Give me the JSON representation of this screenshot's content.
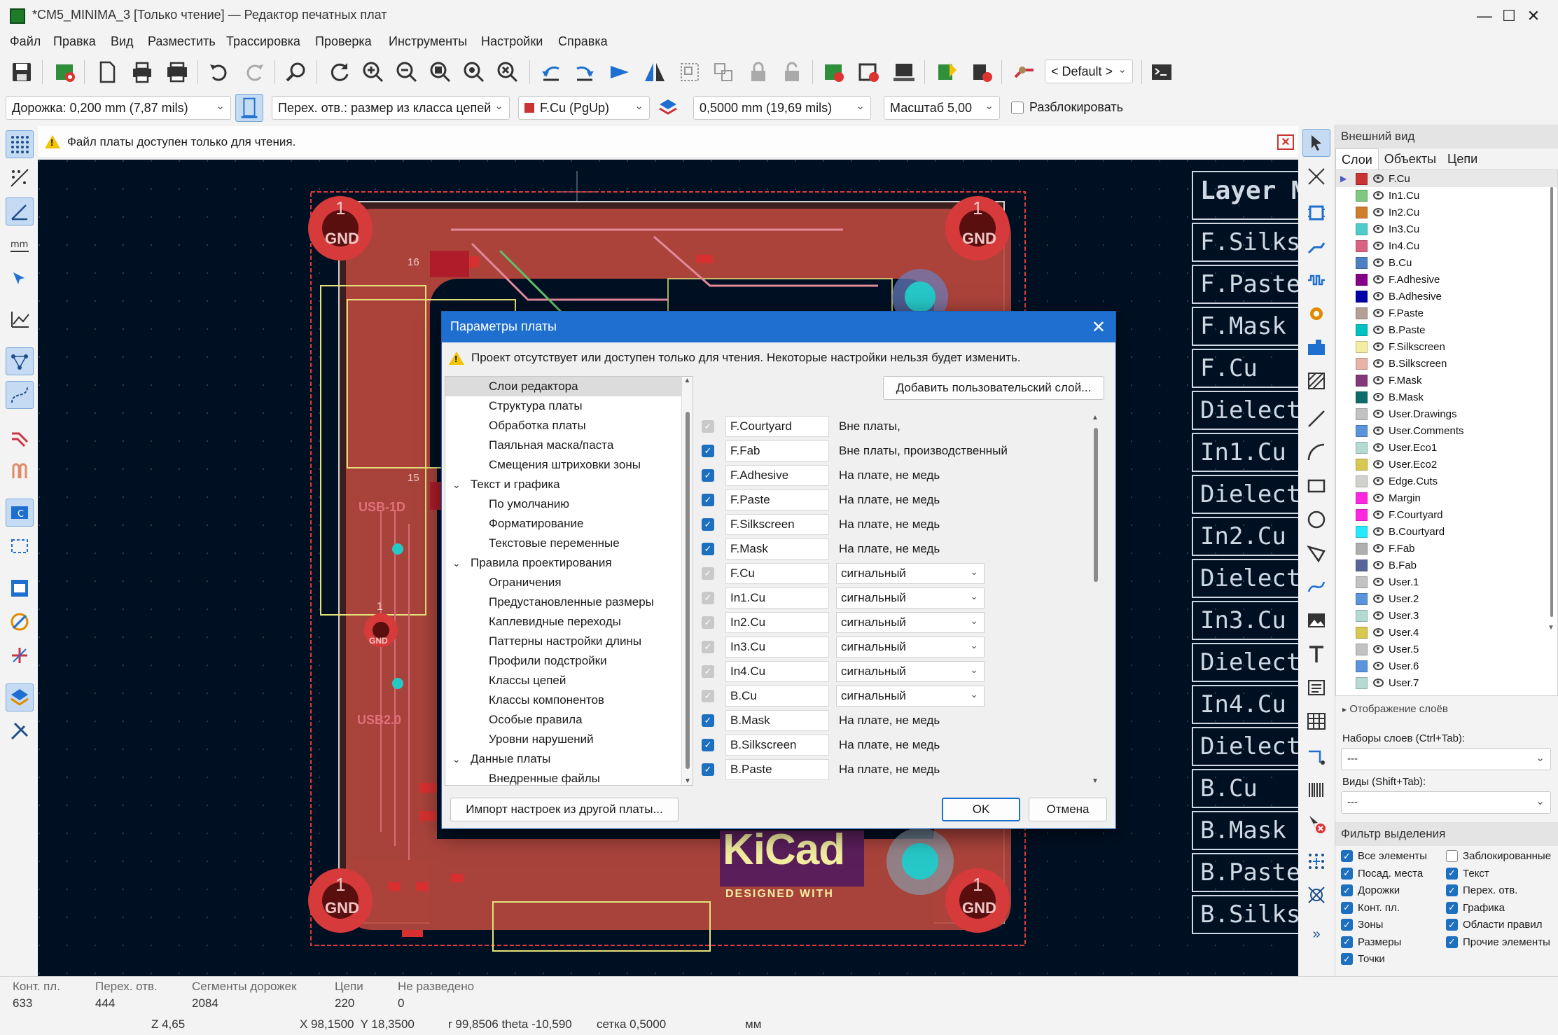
{
  "window": {
    "title": "*CM5_MINIMA_3 [Только чтение] — Редактор печатных плат",
    "controls": {
      "minimize": "—",
      "maximize": "☐",
      "close": "✕"
    }
  },
  "menu": [
    "Файл",
    "Правка",
    "Вид",
    "Разместить",
    "Трассировка",
    "Проверка",
    "Инструменты",
    "Настройки",
    "Справка"
  ],
  "toolbar": {
    "viewport_preset": "< Default >"
  },
  "auxbar": {
    "track_width": "Дорожка: 0,200 mm (7,87 mils)",
    "via_size": "Перех. отв.: размер из класса цепей",
    "layer": "F.Cu (PgUp)",
    "grid": "0,5000 mm (19,69 mils)",
    "zoom": "Масштаб 5,00",
    "unlock_label": "Разблокировать"
  },
  "infobar": {
    "message": "Файл платы доступен только для чтения."
  },
  "canvas": {
    "gnd_label": "GND",
    "pad_number": "1",
    "kicad_text": "KiCad",
    "kicad_sub": "DESIGNED WITH",
    "labels": [
      "16",
      "15",
      "USB-1D",
      "USB2.0"
    ],
    "layer_manager": [
      "Layer M",
      "F.Silksc",
      "F.Paste",
      "F.Mask",
      "F.Cu",
      "Dielect",
      "In1.Cu",
      "Dielect",
      "In2.Cu",
      "Dielect",
      "In3.Cu",
      "Dielect",
      "In4.Cu",
      "Dielect",
      "B.Cu",
      "B.Mask",
      "B.Paste",
      "B.Silksc"
    ]
  },
  "appearance": {
    "title": "Внешний вид",
    "tabs": [
      "Слои",
      "Объекты",
      "Цепи"
    ],
    "layers": [
      {
        "name": "F.Cu",
        "color": "#c83434"
      },
      {
        "name": "In1.Cu",
        "color": "#7fc87f"
      },
      {
        "name": "In2.Cu",
        "color": "#ce7d2c"
      },
      {
        "name": "In3.Cu",
        "color": "#4fcbcb"
      },
      {
        "name": "In4.Cu",
        "color": "#db6283"
      },
      {
        "name": "B.Cu",
        "color": "#4d7fc4"
      },
      {
        "name": "F.Adhesive",
        "color": "#84008a"
      },
      {
        "name": "B.Adhesive",
        "color": "#0000a8"
      },
      {
        "name": "F.Paste",
        "color": "#b49f94"
      },
      {
        "name": "B.Paste",
        "color": "#00c2c2"
      },
      {
        "name": "F.Silkscreen",
        "color": "#f2eda1"
      },
      {
        "name": "B.Silkscreen",
        "color": "#e8b2a7"
      },
      {
        "name": "F.Mask",
        "color": "#84377a"
      },
      {
        "name": "B.Mask",
        "color": "#0e6b6b"
      },
      {
        "name": "User.Drawings",
        "color": "#c2c2c2"
      },
      {
        "name": "User.Comments",
        "color": "#5994dc"
      },
      {
        "name": "User.Eco1",
        "color": "#b4dbd2"
      },
      {
        "name": "User.Eco2",
        "color": "#d8c852"
      },
      {
        "name": "Edge.Cuts",
        "color": "#d0d2cd"
      },
      {
        "name": "Margin",
        "color": "#ff26e2"
      },
      {
        "name": "F.Courtyard",
        "color": "#ff26e2"
      },
      {
        "name": "B.Courtyard",
        "color": "#26e9ff"
      },
      {
        "name": "F.Fab",
        "color": "#afafaf"
      },
      {
        "name": "B.Fab",
        "color": "#58659b"
      },
      {
        "name": "User.1",
        "color": "#c2c2c2"
      },
      {
        "name": "User.2",
        "color": "#5994dc"
      },
      {
        "name": "User.3",
        "color": "#b4dbd2"
      },
      {
        "name": "User.4",
        "color": "#d8c852"
      },
      {
        "name": "User.5",
        "color": "#c2c2c2"
      },
      {
        "name": "User.6",
        "color": "#5994dc"
      },
      {
        "name": "User.7",
        "color": "#b4dbd2"
      }
    ],
    "layer_display": "Отображение слоёв",
    "presets_label": "Наборы слоев (Ctrl+Tab):",
    "presets_value": "---",
    "views_label": "Виды (Shift+Tab):",
    "views_value": "---",
    "filter_title": "Фильтр выделения",
    "filter": [
      {
        "label": "Все элементы",
        "checked": true
      },
      {
        "label": "Заблокированные",
        "checked": false
      },
      {
        "label": "Посад. места",
        "checked": true
      },
      {
        "label": "Текст",
        "checked": true
      },
      {
        "label": "Дорожки",
        "checked": true
      },
      {
        "label": "Перех. отв.",
        "checked": true
      },
      {
        "label": "Конт. пл.",
        "checked": true
      },
      {
        "label": "Графика",
        "checked": true
      },
      {
        "label": "Зоны",
        "checked": true
      },
      {
        "label": "Области правил",
        "checked": true
      },
      {
        "label": "Размеры",
        "checked": true
      },
      {
        "label": "Прочие элементы",
        "checked": true
      },
      {
        "label": "Точки",
        "checked": true
      }
    ]
  },
  "status": {
    "items": [
      {
        "label": "Конт. пл.",
        "value": "633"
      },
      {
        "label": "Перех. отв.",
        "value": "444"
      },
      {
        "label": "Сегменты дорожек",
        "value": "2084"
      },
      {
        "label": "Цепи",
        "value": "220"
      },
      {
        "label": "Не разведено",
        "value": "0"
      }
    ],
    "z": "Z 4,65",
    "xy": "X 98,1500  Y 18,3500",
    "polar": "r 99,8506  theta -10,590",
    "grid": "сетка 0,5000",
    "units": "мм"
  },
  "dialog": {
    "title": "Параметры платы",
    "warning": "Проект отсутствует или доступен только для чтения. Некоторые настройки нельзя будет изменить.",
    "tree": [
      {
        "label": "Слои редактора",
        "level": 1,
        "selected": true
      },
      {
        "label": "Структура платы",
        "level": 1
      },
      {
        "label": "Обработка платы",
        "level": 1
      },
      {
        "label": "Паяльная маска/паста",
        "level": 1
      },
      {
        "label": "Смещения штриховки зоны",
        "level": 1
      },
      {
        "label": "Текст и графика",
        "level": 0
      },
      {
        "label": "По умолчанию",
        "level": 1
      },
      {
        "label": "Форматирование",
        "level": 1
      },
      {
        "label": "Текстовые переменные",
        "level": 1
      },
      {
        "label": "Правила проектирования",
        "level": 0
      },
      {
        "label": "Ограничения",
        "level": 1
      },
      {
        "label": "Предустановленные размеры",
        "level": 1
      },
      {
        "label": "Каплевидные переходы",
        "level": 1
      },
      {
        "label": "Паттерны настройки длины",
        "level": 1
      },
      {
        "label": "Профили подстройки",
        "level": 1
      },
      {
        "label": "Классы цепей",
        "level": 1
      },
      {
        "label": "Классы компонентов",
        "level": 1
      },
      {
        "label": "Особые правила",
        "level": 1
      },
      {
        "label": "Уровни нарушений",
        "level": 1
      },
      {
        "label": "Данные платы",
        "level": 0
      },
      {
        "label": "Внедренные файлы",
        "level": 1
      }
    ],
    "add_layer": "Добавить пользовательский слой...",
    "rows": [
      {
        "name": "F.Courtyard",
        "state": "dis",
        "type": "Вне платы,",
        "select": false
      },
      {
        "name": "F.Fab",
        "state": "on",
        "type": "Вне платы, производственный",
        "select": false
      },
      {
        "name": "F.Adhesive",
        "state": "on",
        "type": "На плате, не медь",
        "select": false
      },
      {
        "name": "F.Paste",
        "state": "on",
        "type": "На плате, не медь",
        "select": false
      },
      {
        "name": "F.Silkscreen",
        "state": "on",
        "type": "На плате, не медь",
        "select": false
      },
      {
        "name": "F.Mask",
        "state": "on",
        "type": "На плате, не медь",
        "select": false
      },
      {
        "name": "F.Cu",
        "state": "dis",
        "type": "сигнальный",
        "select": true
      },
      {
        "name": "In1.Cu",
        "state": "dis",
        "type": "сигнальный",
        "select": true
      },
      {
        "name": "In2.Cu",
        "state": "dis",
        "type": "сигнальный",
        "select": true
      },
      {
        "name": "In3.Cu",
        "state": "dis",
        "type": "сигнальный",
        "select": true
      },
      {
        "name": "In4.Cu",
        "state": "dis",
        "type": "сигнальный",
        "select": true
      },
      {
        "name": "B.Cu",
        "state": "dis",
        "type": "сигнальный",
        "select": true
      },
      {
        "name": "B.Mask",
        "state": "on",
        "type": "На плате, не медь",
        "select": false
      },
      {
        "name": "B.Silkscreen",
        "state": "on",
        "type": "На плате, не медь",
        "select": false
      },
      {
        "name": "B.Paste",
        "state": "on",
        "type": "На плате, не медь",
        "select": false
      }
    ],
    "import_btn": "Импорт настроек из другой платы...",
    "ok": "OK",
    "cancel": "Отмена"
  }
}
